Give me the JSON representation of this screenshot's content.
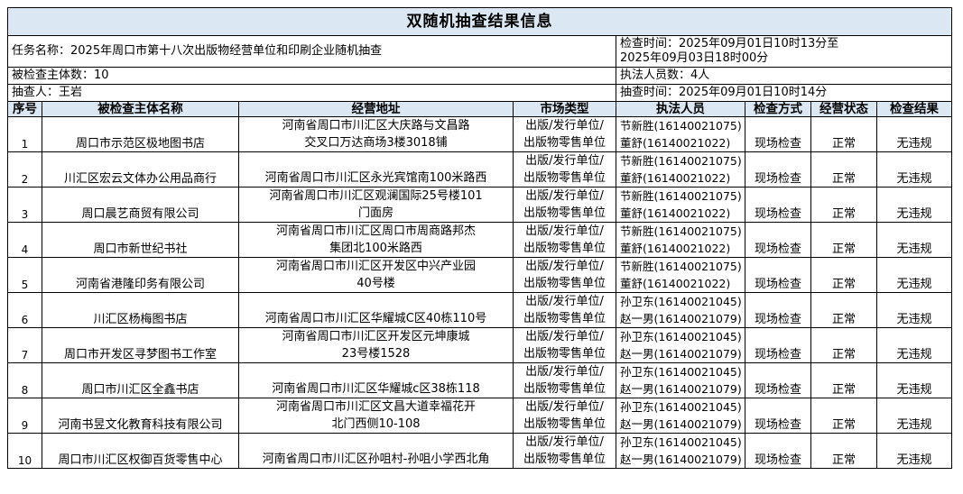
{
  "title": "双随机抽查结果信息",
  "info": {
    "task_name": "任务名称：2025年周口市第十八次出版物经营单位和印刷企业随机抽查",
    "check_time_line1": "检查时间：2025年09月01日10时13分至",
    "check_time_line2": "2025年09月03日18时00分",
    "subject_count": "被检查主体数：10",
    "staff_count": "执法人员数：4人",
    "drawer": "抽查人：王岩",
    "draw_time": "抽查时间：2025年09月01日10时14分"
  },
  "headers": [
    "序号",
    "被检查主体名称",
    "经营地址",
    "市场类型",
    "执法人员",
    "检查方式",
    "经营状态",
    "检查结果"
  ],
  "rows": [
    {
      "seq": "1",
      "name": "周口市示范区极地图书店",
      "addr1": "河南省周口市川汇区大庆路与文昌路",
      "addr2": "交叉口万达商场3楼3018铺",
      "type1": "出版/发行单位/",
      "type2": "出版物零售单位",
      "staff1": "节新胜(16140021075)",
      "staff2": "董舒(16140021022)",
      "method": "现场检查",
      "status": "正常",
      "result": "无违规"
    },
    {
      "seq": "2",
      "name": "川汇区宏云文体办公用品商行",
      "addr1": "",
      "addr2": "河南省周口市川汇区永光宾馆南100米路西",
      "type1": "出版/发行单位/",
      "type2": "出版物零售单位",
      "staff1": "节新胜(16140021075)",
      "staff2": "董舒(16140021022)",
      "method": "现场检查",
      "status": "正常",
      "result": "无违规"
    },
    {
      "seq": "3",
      "name": "周口晨艺商贸有限公司",
      "addr1": "河南省周口市川汇区观澜国际25号楼101",
      "addr2": "门面房",
      "type1": "出版/发行单位/",
      "type2": "出版物零售单位",
      "staff1": "节新胜(16140021075)",
      "staff2": "董舒(16140021022)",
      "method": "现场检查",
      "status": "正常",
      "result": "无违规"
    },
    {
      "seq": "4",
      "name": "周口市新世纪书社",
      "addr1": "河南省周口市川汇区周口市周商路邦杰",
      "addr2": "集团北100米路西",
      "type1": "出版/发行单位/",
      "type2": "出版物零售单位",
      "staff1": "节新胜(16140021075)",
      "staff2": "董舒(16140021022)",
      "method": "现场检查",
      "status": "正常",
      "result": "无违规"
    },
    {
      "seq": "5",
      "name": "河南省港隆印务有限公司",
      "addr1": "河南省周口市川汇区开发区中兴产业园",
      "addr2": "40号楼",
      "type1": "出版/发行单位/",
      "type2": "出版物零售单位",
      "staff1": "节新胜(16140021075)",
      "staff2": "董舒(16140021022)",
      "method": "现场检查",
      "status": "正常",
      "result": "无违规"
    },
    {
      "seq": "6",
      "name": "川汇区杨梅图书店",
      "addr1": "",
      "addr2": "河南省周口市川汇区华耀城C区40栋110号",
      "type1": "出版/发行单位/",
      "type2": "出版物零售单位",
      "staff1": "孙卫东(16140021045)",
      "staff2": "赵一男(16140021079)",
      "method": "现场检查",
      "status": "正常",
      "result": "无违规"
    },
    {
      "seq": "7",
      "name": "周口市开发区寻梦图书工作室",
      "addr1": "河南省周口市川汇区开发区元坤康城",
      "addr2": "23号楼1528",
      "type1": "出版/发行单位/",
      "type2": "出版物零售单位",
      "staff1": "孙卫东(16140021045)",
      "staff2": "赵一男(16140021079)",
      "method": "现场检查",
      "status": "正常",
      "result": "无违规"
    },
    {
      "seq": "8",
      "name": "周口市川汇区全鑫书店",
      "addr1": "",
      "addr2": "河南省周口市川汇区华耀城c区38栋118",
      "type1": "出版/发行单位/",
      "type2": "出版物零售单位",
      "staff1": "孙卫东(16140021045)",
      "staff2": "赵一男(16140021079)",
      "method": "现场检查",
      "status": "正常",
      "result": "无违规"
    },
    {
      "seq": "9",
      "name": "河南书昱文化教育科技有限公司",
      "addr1": "河南省周口市川汇区文昌大道幸福花开",
      "addr2": "北门西侧10-108",
      "type1": "出版/发行单位/",
      "type2": "出版物零售单位",
      "staff1": "孙卫东(16140021045)",
      "staff2": "赵一男(16140021079)",
      "method": "现场检查",
      "status": "正常",
      "result": "无违规"
    },
    {
      "seq": "10",
      "name": "周口市川汇区权御百货零售中心",
      "addr1": "",
      "addr2": "河南省周口市川汇区孙咀村-孙咀小学西北角",
      "type1": "出版/发行单位/",
      "type2": "出版物零售单位",
      "staff1": "孙卫东(16140021045)",
      "staff2": "赵一男(16140021079)",
      "method": "现场检查",
      "status": "正常",
      "result": "无违规"
    }
  ]
}
